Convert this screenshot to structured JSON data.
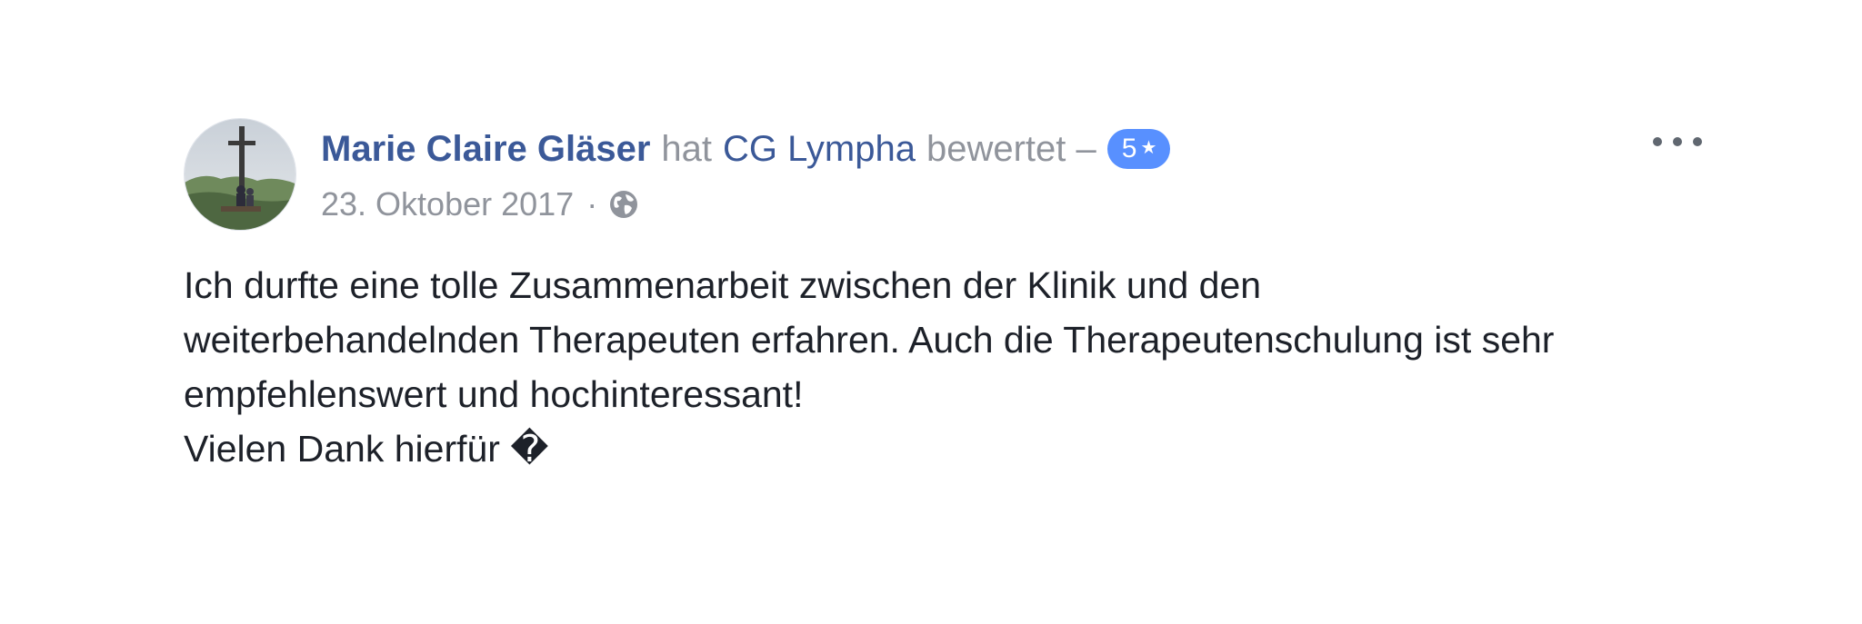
{
  "review": {
    "author_name": "Marie Claire Gläser",
    "action_prefix": "hat",
    "page_name": "CG Lympha",
    "action_suffix": "bewertet –",
    "rating": "5",
    "rating_star": "★",
    "date": "23. Oktober 2017",
    "separator": "·",
    "privacy_icon": "globe-icon",
    "more_icon": "more-dots-icon",
    "text_lines": [
      "Ich durfte eine tolle Zusammenarbeit zwischen der Klinik und den",
      "weiterbehandelnden Therapeuten erfahren. Auch die Therapeutenschulung ist sehr",
      "empfehlenswert und hochinteressant!",
      "Vielen Dank hierfür �"
    ]
  },
  "colors": {
    "link": "#3b5998",
    "muted": "#90949c",
    "badge": "#5890ff",
    "text": "#1d2129"
  }
}
